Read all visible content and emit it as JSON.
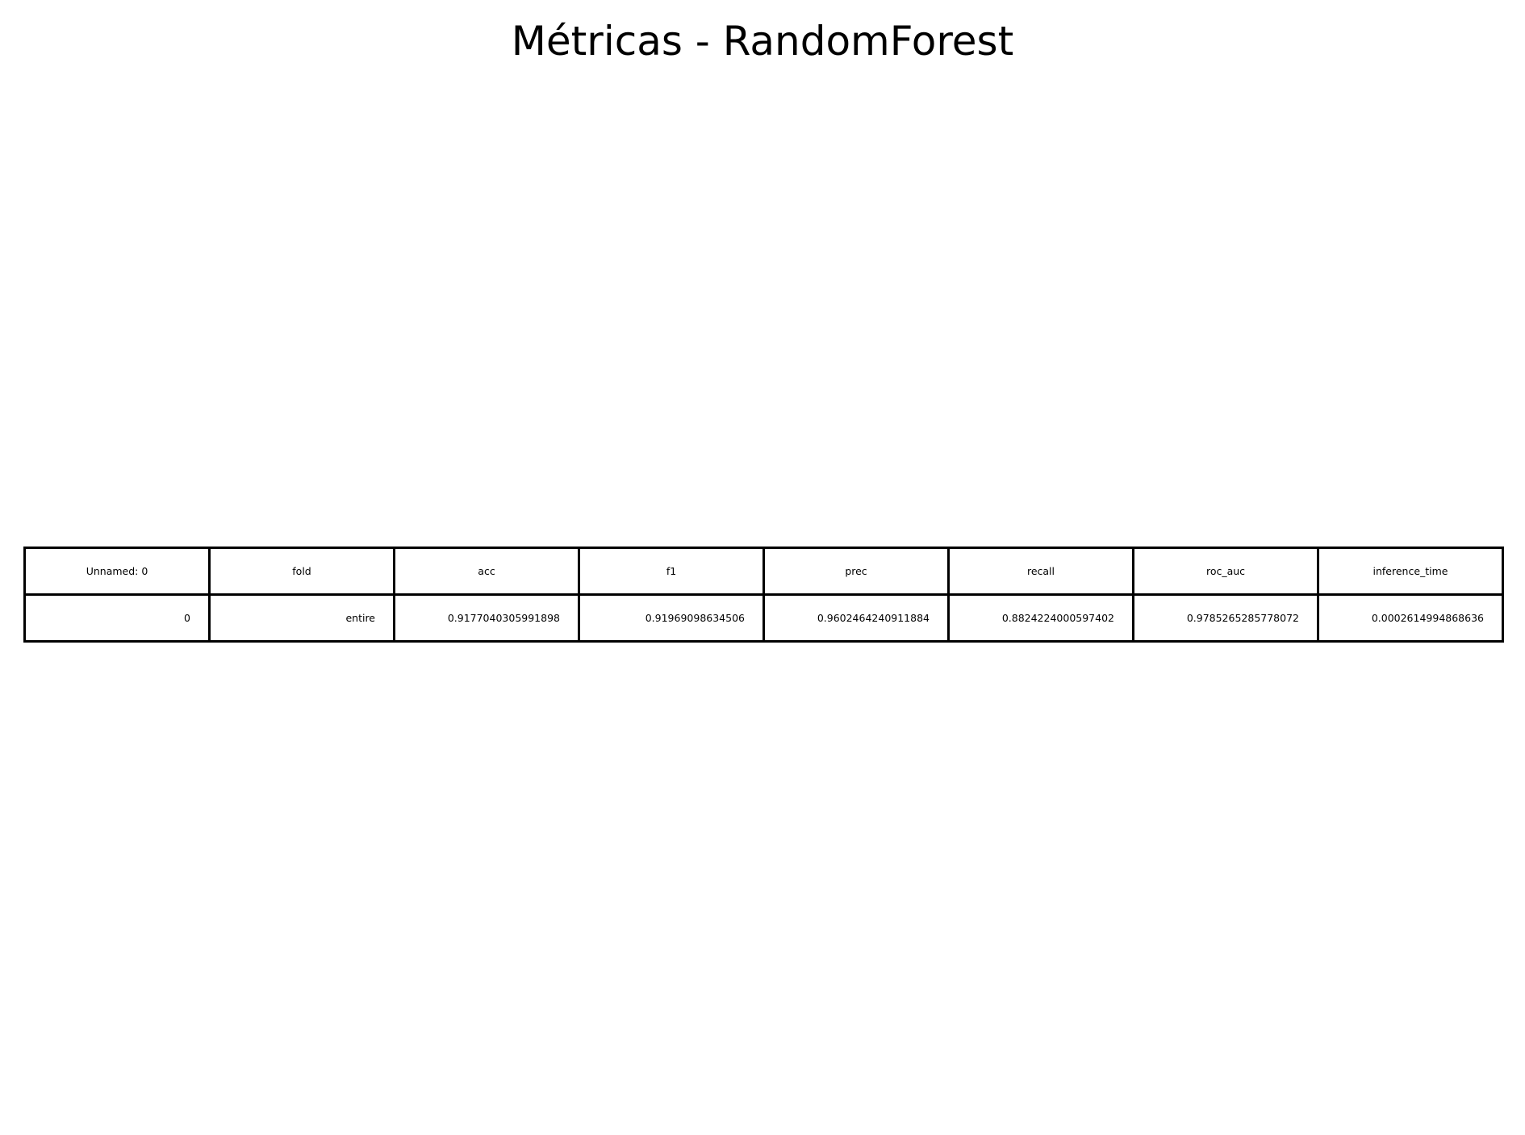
{
  "chart_data": {
    "type": "table",
    "title": "Métricas - RandomForest",
    "columns": [
      "Unnamed: 0",
      "fold",
      "acc",
      "f1",
      "prec",
      "recall",
      "roc_auc",
      "inference_time"
    ],
    "rows": [
      [
        "0",
        "entire",
        "0.9177040305991898",
        "0.91969098634506",
        "0.9602464240911884",
        "0.8824224000597402",
        "0.9785265285778072",
        "0.0002614994868636"
      ]
    ]
  }
}
